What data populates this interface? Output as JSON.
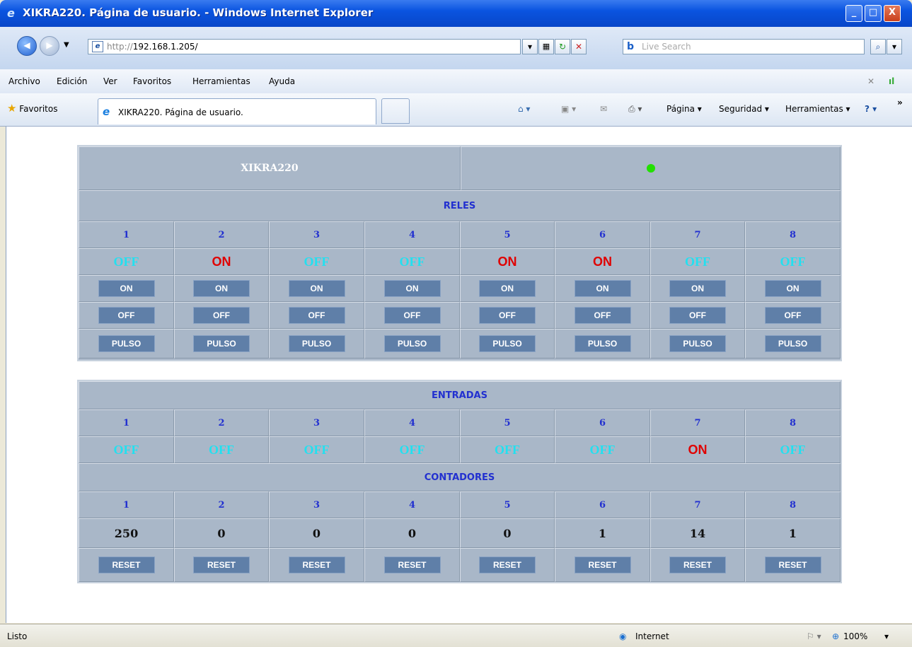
{
  "window": {
    "title": "XIKRA220. Página de usuario. - Windows Internet Explorer",
    "minimize": "_",
    "maximize": "□",
    "close": "X"
  },
  "address": {
    "url_prefix": "http://",
    "url_host": "192.168.1.205/",
    "search_placeholder": "Live Search"
  },
  "menu": [
    "Archivo",
    "Edición",
    "Ver",
    "Favoritos",
    "Herramientas",
    "Ayuda"
  ],
  "favorites_label": "Favoritos",
  "tab_title": "XIKRA220. Página de usuario.",
  "commands": {
    "pagina": "Página ▾",
    "seguridad": "Seguridad ▾",
    "herramientas": "Herramientas ▾"
  },
  "status": {
    "left": "Listo",
    "zone": "Internet",
    "zoom": "100%"
  },
  "device": {
    "name": "XIKRA220",
    "led_color": "#22e000"
  },
  "reles": {
    "title": "RELES",
    "numbers": [
      "1",
      "2",
      "3",
      "4",
      "5",
      "6",
      "7",
      "8"
    ],
    "states": [
      "OFF",
      "ON",
      "OFF",
      "OFF",
      "ON",
      "ON",
      "OFF",
      "OFF"
    ],
    "on_label": "ON",
    "off_label": "OFF",
    "pulse_label": "PULSO"
  },
  "entradas": {
    "title": "ENTRADAS",
    "numbers": [
      "1",
      "2",
      "3",
      "4",
      "5",
      "6",
      "7",
      "8"
    ],
    "states": [
      "OFF",
      "OFF",
      "OFF",
      "OFF",
      "OFF",
      "OFF",
      "ON",
      "OFF"
    ]
  },
  "contadores": {
    "title": "CONTADORES",
    "numbers": [
      "1",
      "2",
      "3",
      "4",
      "5",
      "6",
      "7",
      "8"
    ],
    "values": [
      "250",
      "0",
      "0",
      "0",
      "0",
      "1",
      "14",
      "1"
    ],
    "reset_label": "RESET"
  }
}
